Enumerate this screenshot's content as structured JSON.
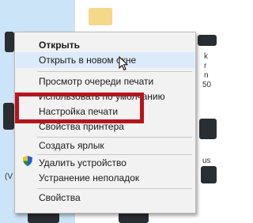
{
  "desktop": {
    "edge_labels": [
      "k",
      "r",
      "n",
      "50",
      "(V",
      "us"
    ]
  },
  "context_menu": {
    "items": [
      {
        "label": "Открыть",
        "bold": true
      },
      {
        "label": "Открыть в новом окне",
        "hover": true
      },
      {
        "label": "Просмотр очереди печати"
      },
      {
        "label": "Использовать по умолчанию"
      },
      {
        "label": "Настройка печати"
      },
      {
        "label": "Свойства принтера"
      },
      {
        "label": "Создать ярлык"
      },
      {
        "label": "Удалить устройство",
        "icon": "uac-shield-icon"
      },
      {
        "label": "Устранение неполадок"
      },
      {
        "label": "Свойства"
      }
    ]
  },
  "colors": {
    "highlight_box": "#b5151b",
    "menu_bg": "#f2f2f2",
    "hover_bg": "#dcebfa",
    "selection_bg": "#cce4f7"
  }
}
